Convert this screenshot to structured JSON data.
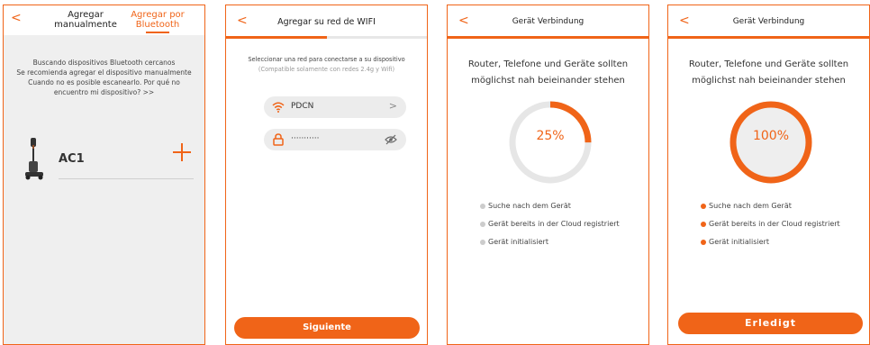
{
  "screen1": {
    "back": "<",
    "tab_manual": "Agregar manualmente",
    "tab_bluetooth": "Agregar por Bluetooth",
    "message_lines": [
      "Buscando dispositivos Bluetooth cercanos",
      "Se recomienda agregar el dispositivo manualmente",
      "Cuando no es posible escanearlo. Por qué no",
      "encuentro mi dispositivo? >>"
    ],
    "device_name": "AC1",
    "device_icon": "vacuum-cleaner-icon",
    "add_icon": "plus-icon"
  },
  "screen2": {
    "back": "<",
    "title": "Agregar su red de WIFI",
    "progress": 0.5,
    "message": "Seleccionar una red para conectarse a su dispositivo",
    "sub_message": "(Compatible solamente con redes 2.4g y Wifi)",
    "wifi_name": "PDCN",
    "wifi_icon": "wifi-icon",
    "chevron": ">",
    "password_mask": "···········",
    "lock_icon": "lock-icon",
    "eye_icon": "eye-hidden-icon",
    "next_label": "Siguiente"
  },
  "screen3": {
    "back": "<",
    "title": "Gerät Verbindung",
    "instruction_lines": [
      "Router, Telefone und Geräte sollten",
      "möglichst nah beieinander stehen"
    ],
    "progress_label": "25%",
    "progress": 0.25,
    "steps": [
      {
        "label": "Suche nach dem Gerät",
        "done": false
      },
      {
        "label": "Gerät bereits in der Cloud registriert",
        "done": false
      },
      {
        "label": "Gerät initialisiert",
        "done": false
      }
    ]
  },
  "screen4": {
    "back": "<",
    "title": "Gerät Verbindung",
    "instruction_lines": [
      "Router, Telefone und Geräte sollten",
      "möglichst nah beieinander stehen"
    ],
    "progress_label": "100%",
    "progress": 1.0,
    "steps": [
      {
        "label": "Suche nach dem Gerät",
        "done": true
      },
      {
        "label": "Gerät bereits in der Cloud registriert",
        "done": true
      },
      {
        "label": "Gerät initialisiert",
        "done": true
      }
    ],
    "done_label": "Erledigt"
  },
  "colors": {
    "accent": "#f06418",
    "pending_dot": "#cccccc",
    "ring_track": "#e6e6e6",
    "panel_gray": "#efefef"
  }
}
